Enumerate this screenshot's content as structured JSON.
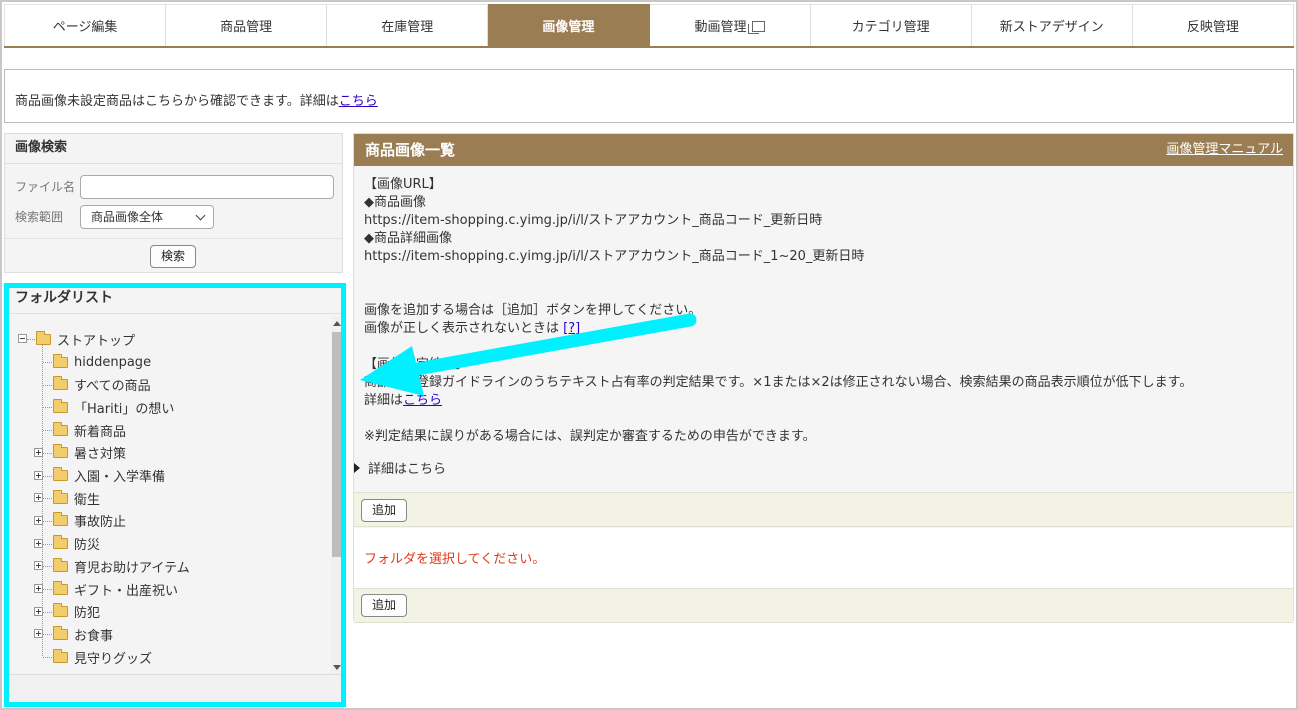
{
  "tabs": [
    {
      "label": "ページ編集",
      "active": false
    },
    {
      "label": "商品管理",
      "active": false
    },
    {
      "label": "在庫管理",
      "active": false
    },
    {
      "label": "画像管理",
      "active": true
    },
    {
      "label": "動画管理",
      "active": false,
      "icon": "window-icon"
    },
    {
      "label": "カテゴリ管理",
      "active": false
    },
    {
      "label": "新ストアデザイン",
      "active": false
    },
    {
      "label": "反映管理",
      "active": false
    }
  ],
  "notice": {
    "text": "商品画像未設定商品はこちらから確認できます。詳細は",
    "link": "こちら"
  },
  "search": {
    "title": "画像検索",
    "file_label": "ファイル名",
    "file_value": "",
    "range_label": "検索範囲",
    "range_selected": "商品画像全体",
    "search_button": "検索"
  },
  "folders": {
    "title": "フォルダリスト",
    "root": "ストアトップ",
    "items": [
      {
        "label": "hiddenpage",
        "expandable": false
      },
      {
        "label": "すべての商品",
        "expandable": false
      },
      {
        "label": "「Hariti」の想い",
        "expandable": false
      },
      {
        "label": "新着商品",
        "expandable": false
      },
      {
        "label": "暑さ対策",
        "expandable": true
      },
      {
        "label": "入園・入学準備",
        "expandable": true
      },
      {
        "label": "衛生",
        "expandable": true
      },
      {
        "label": "事故防止",
        "expandable": true
      },
      {
        "label": "防災",
        "expandable": true
      },
      {
        "label": "育児お助けアイテム",
        "expandable": true
      },
      {
        "label": "ギフト・出産祝い",
        "expandable": true
      },
      {
        "label": "防犯",
        "expandable": true
      },
      {
        "label": "お食事",
        "expandable": true
      },
      {
        "label": "見守りグッズ",
        "expandable": false
      }
    ]
  },
  "main": {
    "title": "商品画像一覧",
    "manual_link": "画像管理マニュアル",
    "url_heading": "【画像URL】",
    "product_image_heading": "◆商品画像",
    "product_image_url": "https://item-shopping.c.yimg.jp/i/l/ストアアカウント_商品コード_更新日時",
    "detail_image_heading": "◆商品詳細画像",
    "detail_image_url": "https://item-shopping.c.yimg.jp/i/l/ストアアカウント_商品コード_1~20_更新日時",
    "add_instruction": "画像を追加する場合は［追加］ボタンを押してください。",
    "display_issue": "画像が正しく表示されないときは",
    "display_issue_link": "[?]",
    "judge_heading": "【画像判定結果】",
    "judge_text": "商品画像登録ガイドラインのうちテキスト占有率の判定結果です。×1または×2は修正されない場合、検索結果の商品表示順位が低下します。",
    "detail_prefix": "詳細は",
    "detail_link": "こちら",
    "misjudge_note": "※判定結果に誤りがある場合には、誤判定か審査するための申告ができます。",
    "details_toggle": "詳細はこちら",
    "add_button": "追加",
    "select_folder_msg": "フォルダを選択してください。"
  },
  "colors": {
    "accent": "#9a7d52",
    "highlight": "#00f0ff",
    "error": "#e03a1a",
    "link": "#2b00c7"
  }
}
